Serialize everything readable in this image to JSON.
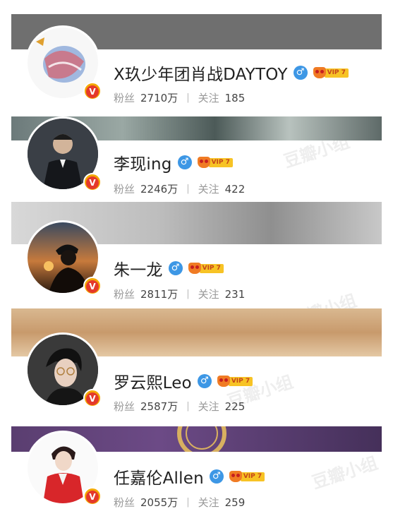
{
  "stats_labels": {
    "fans": "粉丝",
    "follow": "关注"
  },
  "vip_label": "VIP 7",
  "gender_symbol": "♂",
  "verified_symbol": "V",
  "watermark": "豆瓣小组",
  "users": [
    {
      "name": "X玖少年团肖战DAYTOY",
      "fans": "2710万",
      "follow": "185"
    },
    {
      "name": "李现ing",
      "fans": "2246万",
      "follow": "422"
    },
    {
      "name": "朱一龙",
      "fans": "2811万",
      "follow": "231"
    },
    {
      "name": "罗云熙Leo",
      "fans": "2587万",
      "follow": "225"
    },
    {
      "name": "任嘉伦Allen",
      "fans": "2055万",
      "follow": "259"
    }
  ],
  "colors": {
    "gender": "#3d97e5",
    "verified": "#f4a800",
    "vip_crown": "#f07b24"
  }
}
